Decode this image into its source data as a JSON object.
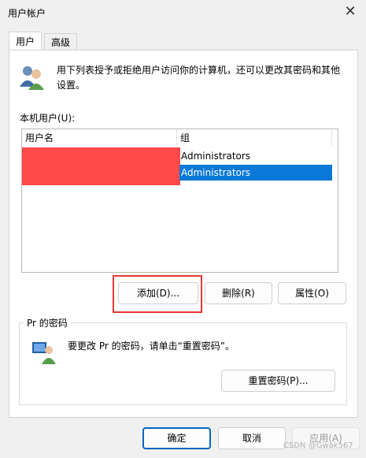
{
  "window": {
    "title": "用户帐户"
  },
  "tabs": [
    {
      "label": "用户"
    },
    {
      "label": "高级"
    }
  ],
  "intro": "用下列表授予或拒绝用户访问你的计算机，还可以更改其密码和其他设置。",
  "list_label": "本机用户(U):",
  "table": {
    "headers": [
      "用户名",
      "组"
    ],
    "rows": [
      {
        "user": "",
        "group": "Administrators"
      },
      {
        "user": "",
        "group": "Administrators",
        "selected": true
      }
    ]
  },
  "user_buttons": {
    "add": "添加(D)...",
    "remove": "删除(R)",
    "properties": "属性(O)"
  },
  "password_group": {
    "label": "Pr 的密码",
    "text": "要更改 Pr 的密码，请单击“重置密码”。",
    "reset_button": "重置密码(P)..."
  },
  "footer_buttons": {
    "ok": "确定",
    "cancel": "取消",
    "apply": "应用(A)"
  },
  "watermark": "CSDN @Gwak567",
  "colors": {
    "selection": "#0a78d7",
    "highlight_box": "#e53935",
    "redaction": "#ff4a4a"
  }
}
